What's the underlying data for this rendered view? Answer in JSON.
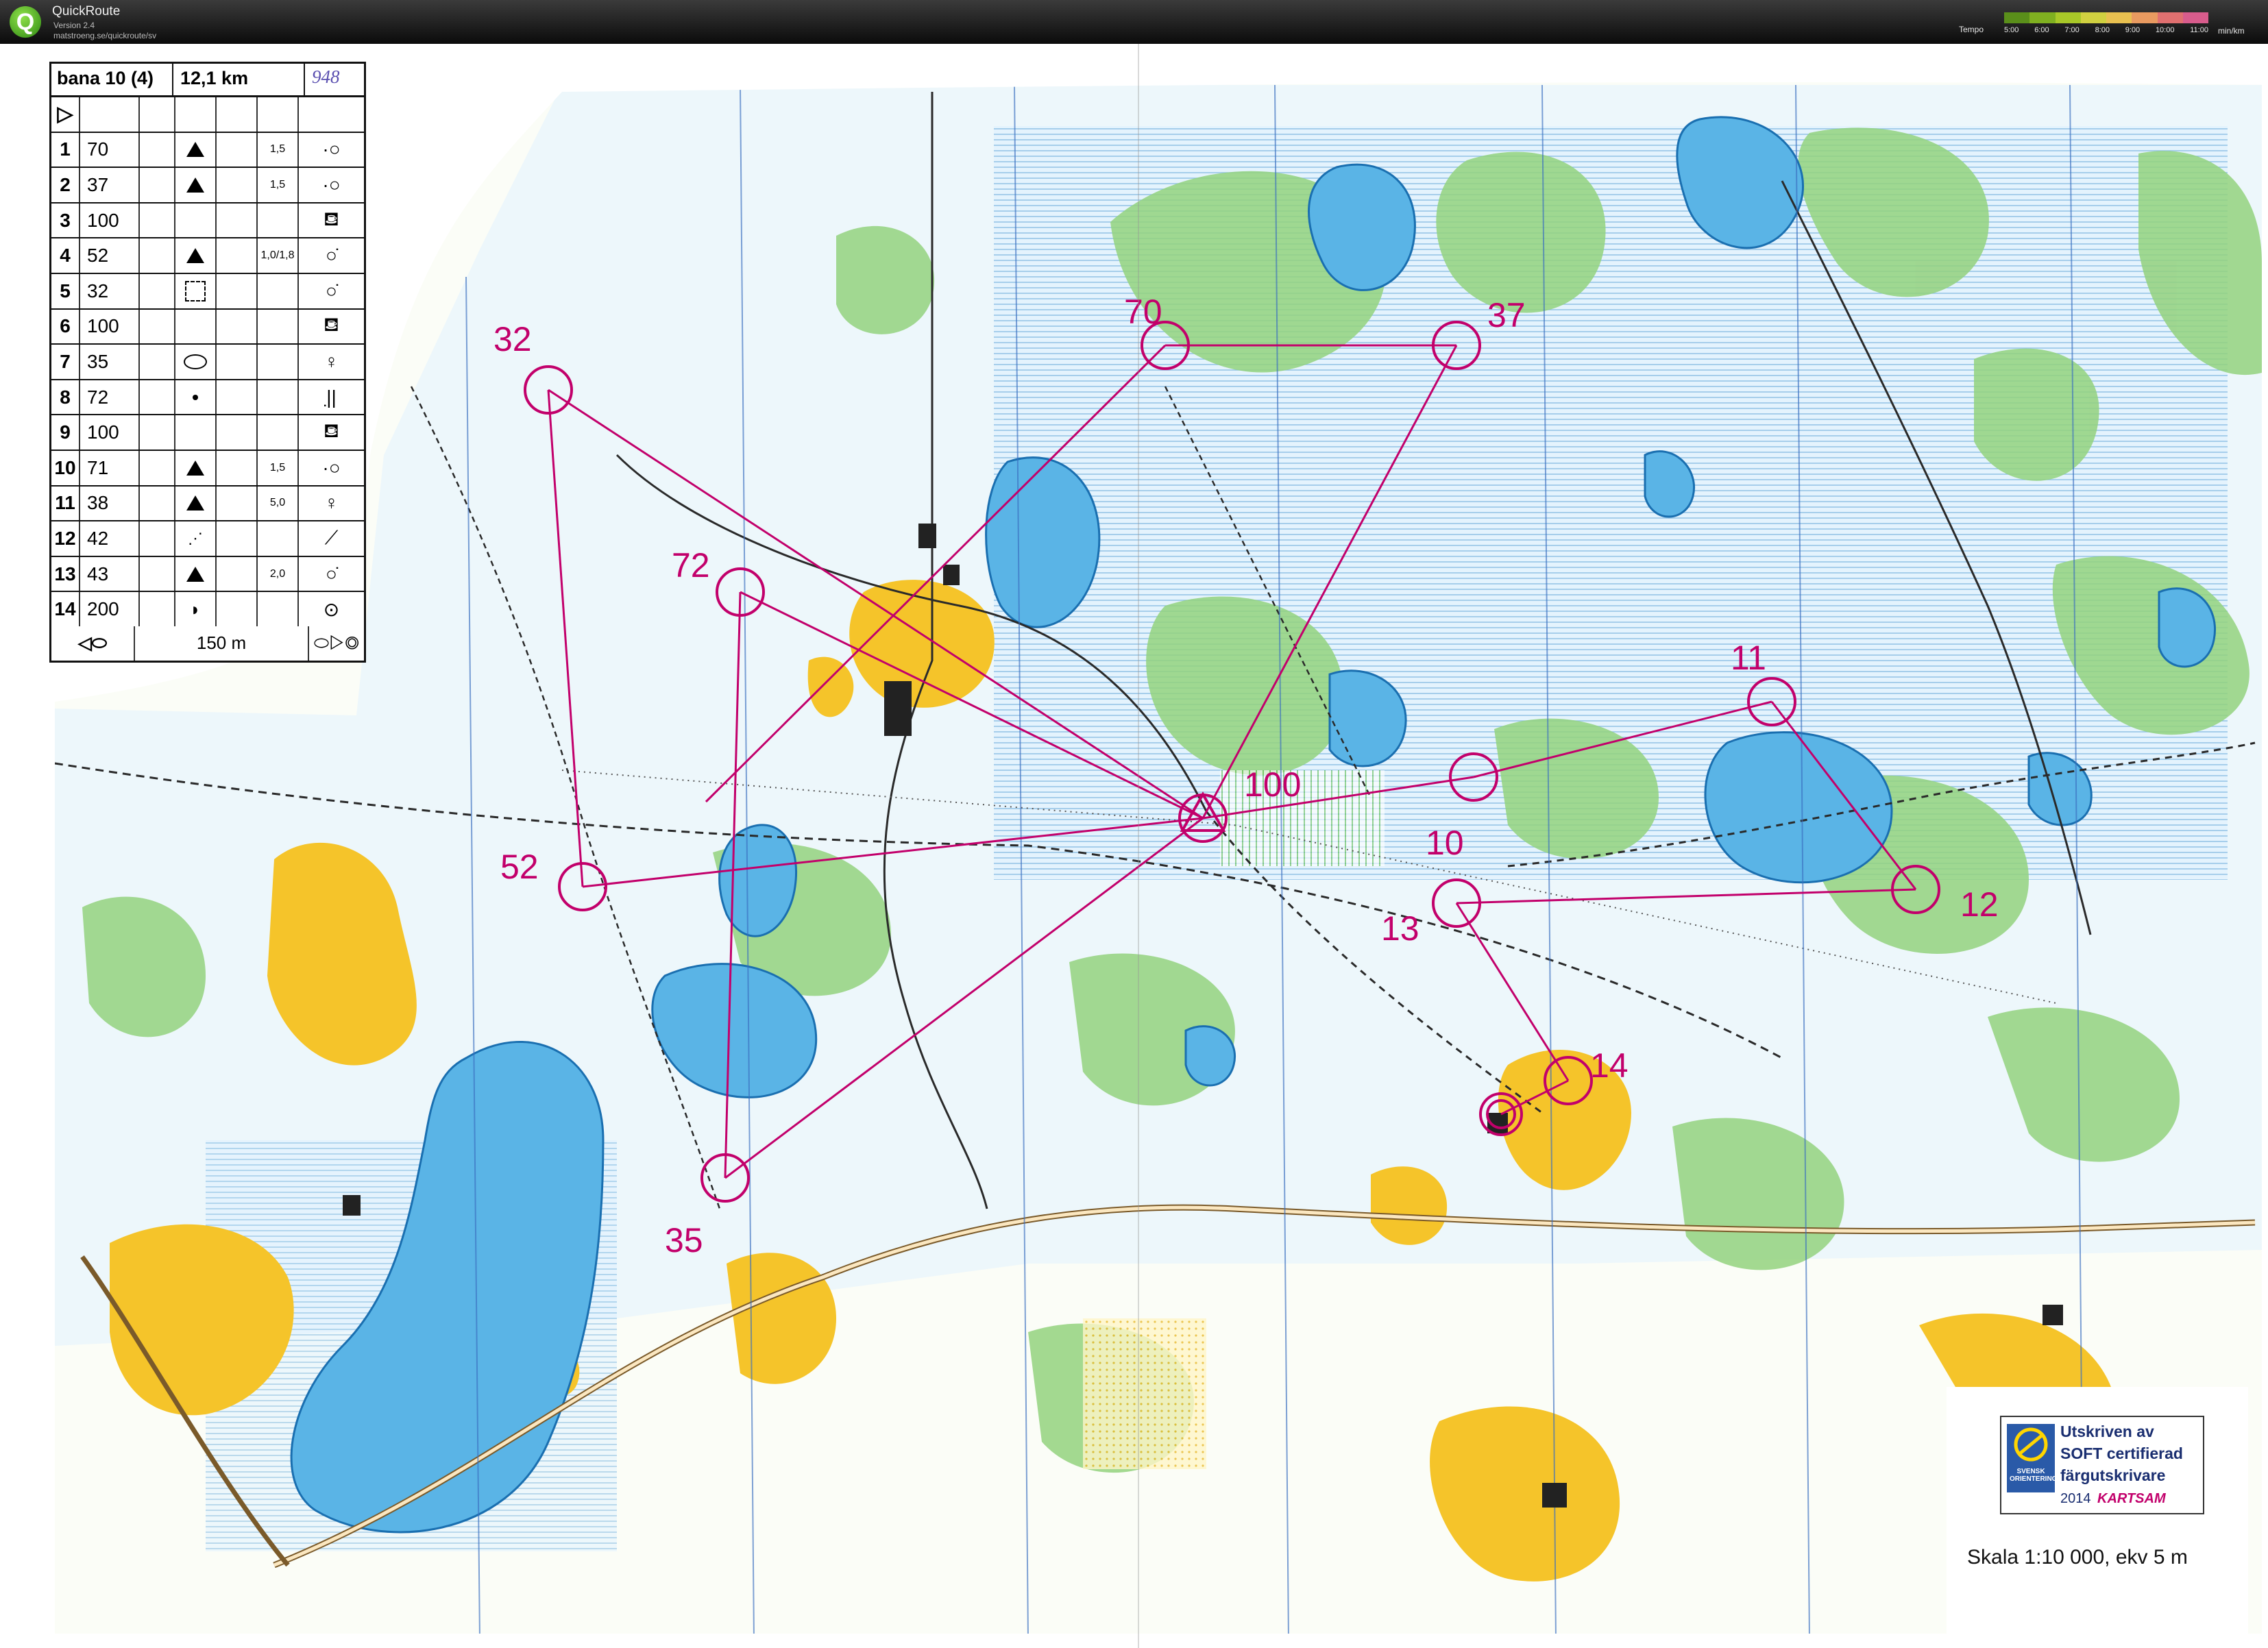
{
  "app": {
    "logo_letter": "Q",
    "name": "QuickRoute",
    "version": "Version 2.4",
    "url": "matstroeng.se/quickroute/sv"
  },
  "tempo": {
    "label": "Tempo",
    "ticks": [
      "5:00",
      "6:00",
      "7:00",
      "8:00",
      "9:00",
      "10:00",
      "11:00"
    ],
    "unit": "min/km",
    "colors": [
      "#5a8f1a",
      "#7fb020",
      "#a8c828",
      "#d0d040",
      "#e8c050",
      "#e89a60",
      "#e07070",
      "#d85c8c"
    ]
  },
  "course": {
    "name": "bana 10 (4)",
    "length": "12,1 km",
    "handwritten": "948",
    "start_symbol": "start-triangle",
    "controls": [
      {
        "n": "1",
        "code": "70",
        "feature": "triangle",
        "size": "1,5",
        "loc": "o-left"
      },
      {
        "n": "2",
        "code": "37",
        "feature": "triangle",
        "size": "1,5",
        "loc": "o-left"
      },
      {
        "n": "3",
        "code": "100",
        "feature": "",
        "size": "",
        "loc": "drink"
      },
      {
        "n": "4",
        "code": "52",
        "feature": "triangle",
        "size": "1,0/1,8",
        "loc": "o-top"
      },
      {
        "n": "5",
        "code": "32",
        "feature": "dashed-square",
        "size": "",
        "loc": "o-top"
      },
      {
        "n": "6",
        "code": "100",
        "feature": "",
        "size": "",
        "loc": "drink"
      },
      {
        "n": "7",
        "code": "35",
        "feature": "ellipse",
        "size": "",
        "loc": "o-bottom"
      },
      {
        "n": "8",
        "code": "72",
        "feature": "dot",
        "size": "",
        "loc": "bracket"
      },
      {
        "n": "9",
        "code": "100",
        "feature": "",
        "size": "",
        "loc": "drink"
      },
      {
        "n": "10",
        "code": "71",
        "feature": "triangle",
        "size": "1,5",
        "loc": "o-left"
      },
      {
        "n": "11",
        "code": "38",
        "feature": "triangle",
        "size": "5,0",
        "loc": "o-bottom"
      },
      {
        "n": "12",
        "code": "42",
        "feature": "dotted-line",
        "size": "",
        "loc": "slash"
      },
      {
        "n": "13",
        "code": "43",
        "feature": "triangle",
        "size": "2,0",
        "loc": "o-top"
      },
      {
        "n": "14",
        "code": "200",
        "feature": "half-circle",
        "size": "",
        "loc": "o-center"
      }
    ],
    "finish": "150 m"
  },
  "map_controls": [
    {
      "label": "70"
    },
    {
      "label": "37"
    },
    {
      "label": "32"
    },
    {
      "label": "72"
    },
    {
      "label": "100"
    },
    {
      "label": "52"
    },
    {
      "label": "10"
    },
    {
      "label": "11"
    },
    {
      "label": "12"
    },
    {
      "label": "13"
    },
    {
      "label": "14"
    },
    {
      "label": "35"
    }
  ],
  "certification": {
    "badge_name": "SVENSK ORIENTERING",
    "line1": "Utskriven av",
    "line2": "SOFT certifierad",
    "line3": "färgutskrivare",
    "year": "2014",
    "brand": "KARTSAM"
  },
  "scale": "Skala 1:10 000, ekv 5 m",
  "colors": {
    "course_magenta": "#c2006b",
    "water": "#5ab4e6",
    "forest_green": "#8fd17a",
    "open_yellow": "#f5c42a"
  }
}
